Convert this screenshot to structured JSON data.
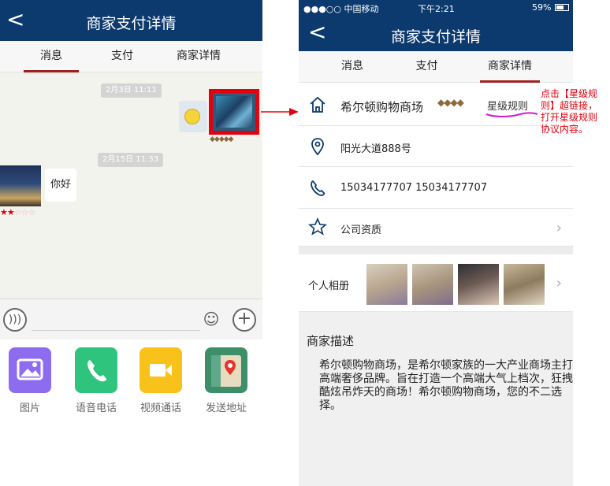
{
  "left_phone": {
    "title": "商家支付详情",
    "back_glyph": "<",
    "tabs": [
      {
        "label": "消息",
        "active": true
      },
      {
        "label": "支付",
        "active": false
      },
      {
        "label": "商家详情",
        "active": false
      }
    ],
    "chat": {
      "time_1": "2月3日 11:11",
      "time_2": "2月15日 11:33",
      "incoming_message": "你好",
      "sender_rating_stars": 2,
      "sender_rating_max": 5
    },
    "panel_apps": [
      {
        "label": "图片",
        "icon": "image-icon",
        "color": "#8e6cf0"
      },
      {
        "label": "语音电话",
        "icon": "phone-icon",
        "color": "#2fc47d"
      },
      {
        "label": "视频通话",
        "icon": "video-icon",
        "color": "#f9c21a"
      },
      {
        "label": "发送地址",
        "icon": "map-pin-icon",
        "color": "#3d8f6a"
      }
    ]
  },
  "right_phone": {
    "status_bar": {
      "carrier": "●●●○○ 中国移动",
      "time": "下午2:21",
      "battery": "59%"
    },
    "title": "商家支付详情",
    "back_glyph": "<",
    "tabs": [
      {
        "label": "消息",
        "active": false
      },
      {
        "label": "支付",
        "active": false
      },
      {
        "label": "商家详情",
        "active": true
      }
    ],
    "store_name": "希尔顿购物商场",
    "star_rule_link": "星级规则",
    "address": "阳光大道888号",
    "phones": "15034177707  15034177707",
    "qualification": "公司资质",
    "album_label": "个人相册",
    "description_title": "商家描述",
    "description_body": "希尔顿购物商场，是希尔顿家族的一大产业商场主打高端奢侈品牌。旨在打造一个高端大气上档次，狂拽酷炫吊炸天的商场！希尔顿购物商场，您的不二选择。"
  },
  "annotation": "点击【星级规则】超链接，打开星级规则协议内容。",
  "colors": {
    "nav": "#0c3a6e",
    "accent": "#e5000f",
    "tab_underline": "#a02020"
  }
}
